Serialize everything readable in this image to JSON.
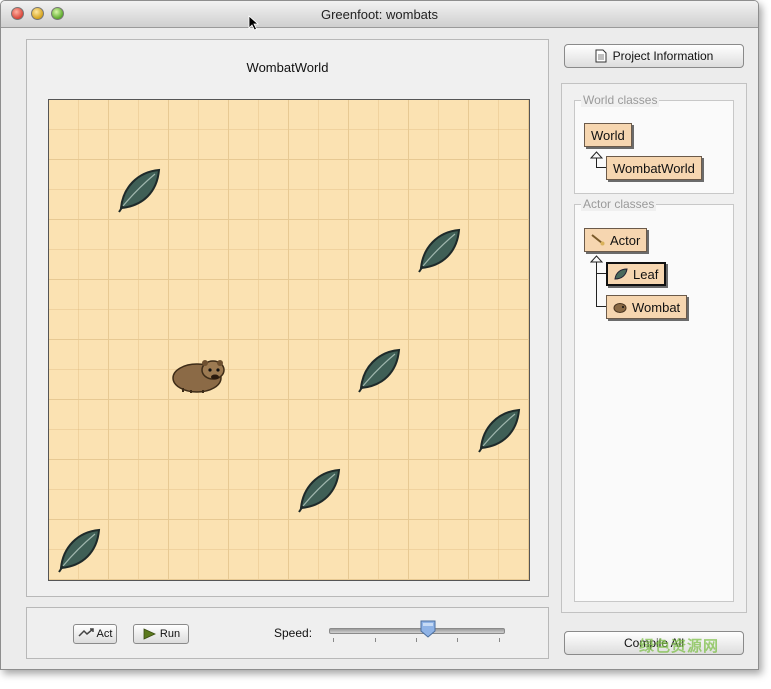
{
  "window": {
    "title": "Greenfoot: wombats"
  },
  "world": {
    "title": "WombatWorld",
    "grid_columns": 8,
    "grid_rows": 8,
    "actors": [
      {
        "type": "leaf",
        "col": 1,
        "row": 1
      },
      {
        "type": "leaf",
        "col": 6,
        "row": 2
      },
      {
        "type": "wombat",
        "col": 2,
        "row": 4
      },
      {
        "type": "leaf",
        "col": 5,
        "row": 4
      },
      {
        "type": "leaf",
        "col": 7,
        "row": 5
      },
      {
        "type": "leaf",
        "col": 4,
        "row": 6
      },
      {
        "type": "leaf",
        "col": 0,
        "row": 7
      }
    ]
  },
  "controls": {
    "act_label": "Act",
    "run_label": "Run",
    "speed_label": "Speed:",
    "speed_fraction": 0.57
  },
  "sidebar": {
    "project_info_label": "Project Information",
    "world_classes_label": "World classes",
    "world_classes": [
      "World",
      "WombatWorld"
    ],
    "actor_classes_label": "Actor classes",
    "actor_classes": [
      "Actor",
      "Leaf",
      "Wombat"
    ],
    "compile_label": "Compile All"
  },
  "colors": {
    "grid_background": "#fbe2b2",
    "class_box": "#f6d6b0",
    "leaf": "#3f5f56"
  },
  "watermark": "绿色资源网"
}
